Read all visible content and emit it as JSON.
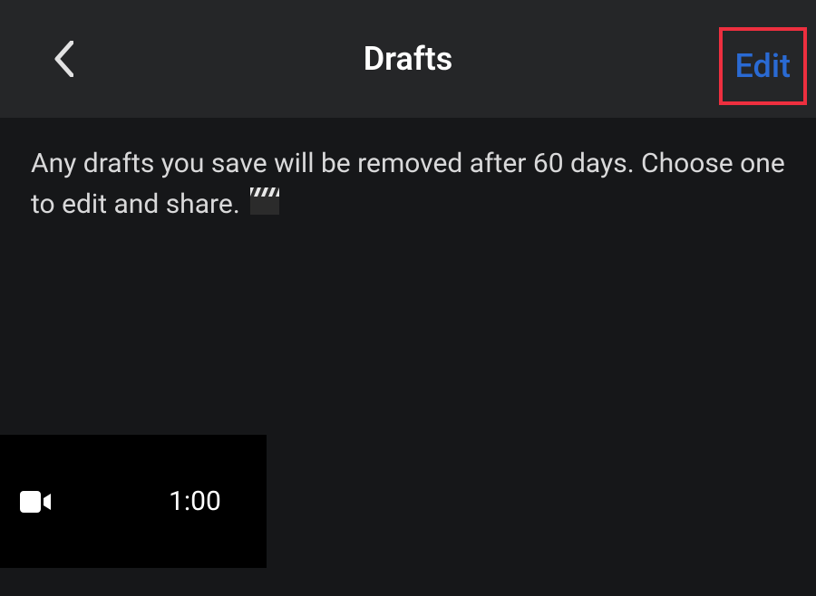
{
  "header": {
    "title": "Drafts",
    "edit_label": "Edit"
  },
  "info": {
    "text": "Any drafts you save will be removed after 60 days. Choose one to edit and share. "
  },
  "drafts": [
    {
      "duration": "1:00"
    }
  ]
}
